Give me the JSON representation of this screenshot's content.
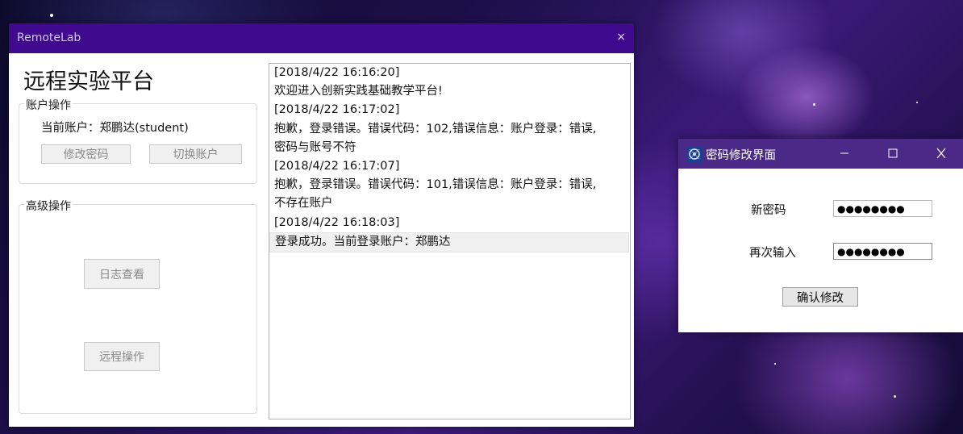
{
  "main_window": {
    "title": "RemoteLab",
    "close_glyph": "×",
    "heading": "远程实验平台",
    "account_group": {
      "legend": "账户操作",
      "current_account": "当前账户：郑鹏达(student)",
      "change_password": "修改密码",
      "switch_account": "切换账户"
    },
    "advanced_group": {
      "legend": "高级操作",
      "view_log": "日志查看",
      "remote_op": "远程操作"
    },
    "log": [
      {
        "text": "[2018/4/22 16:16:20]",
        "selected": false
      },
      {
        "text": "欢迎进入创新实践基础教学平台!",
        "selected": false
      },
      {
        "text": "[2018/4/22 16:17:02]",
        "selected": false
      },
      {
        "text": "抱歉，登录错误。错误代码：102,错误信息：账户登录：错误,",
        "selected": false
      },
      {
        "text": "密码与账号不符",
        "selected": false
      },
      {
        "text": "[2018/4/22 16:17:07]",
        "selected": false
      },
      {
        "text": "抱歉，登录错误。错误代码：101,错误信息：账户登录：错误,",
        "selected": false
      },
      {
        "text": "不存在账户",
        "selected": false
      },
      {
        "text": "[2018/4/22 16:18:03]",
        "selected": false
      },
      {
        "text": "登录成功。当前登录账户：郑鹏达",
        "selected": true
      }
    ]
  },
  "password_dialog": {
    "title": "密码修改界面",
    "new_password_label": "新密码",
    "confirm_password_label": "再次输入",
    "new_password_value": "●●●●●●●●",
    "confirm_password_value": "●●●●●●●●",
    "confirm_button": "确认修改"
  },
  "colors": {
    "main_titlebar": "#3f0a8e",
    "dialog_titlebar": "#4a2a86"
  }
}
